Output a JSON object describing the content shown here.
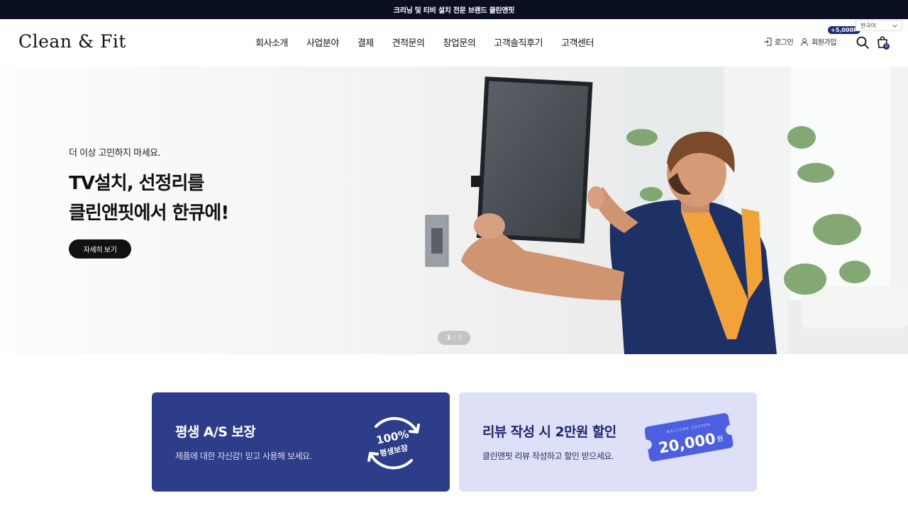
{
  "topbar": {
    "text": "크리닝 및 티비 설치 전문 브랜드 클린앤핏"
  },
  "header": {
    "logo": "Clean & Fit",
    "nav": [
      "회사소개",
      "사업분야",
      "결제",
      "견적문의",
      "창업문의",
      "고객솔직후기",
      "고객센터"
    ],
    "login_label": "로그인",
    "signup_label": "회원가입",
    "point_badge": "+5,000P",
    "language": "한국어",
    "cart_count": "0"
  },
  "hero": {
    "subtitle": "더 이상 고민하지 마세요.",
    "title_line1": "TV설치, 선정리를",
    "title_line2": "클린앤핏에서 한큐에!",
    "cta_label": "자세히 보기",
    "slide_current": "1",
    "slide_separator": "/",
    "slide_total": "3"
  },
  "promo_cards": [
    {
      "title": "평생 A/S 보장",
      "description": "제품에 대한 자신감! 믿고 사용해 보세요.",
      "badge_top": "100%",
      "badge_bottom": "평생보장"
    },
    {
      "title": "리뷰 작성 시 2만원 할인",
      "description": "클린앤핏 리뷰 작성하고 할인 받으세요.",
      "coupon_label": "WELCOME COUPON",
      "coupon_amount": "20,000",
      "coupon_unit": "원"
    }
  ],
  "colors": {
    "topbar_bg": "#0b0f22",
    "navy_card": "#2e3d8a",
    "lavender_card": "#dde0f7",
    "coupon_blue": "#4b5fe0"
  }
}
